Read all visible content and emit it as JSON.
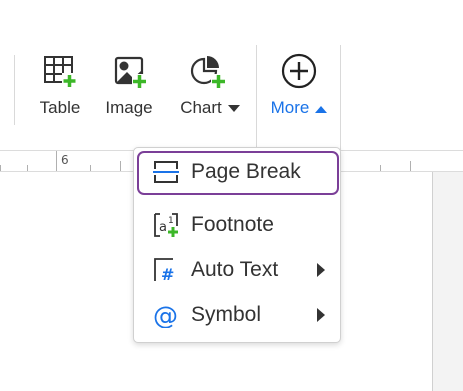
{
  "toolbar": {
    "table_label": "Table",
    "image_label": "Image",
    "chart_label": "Chart",
    "more_label": "More"
  },
  "ruler": {
    "mark": "6"
  },
  "more_menu": {
    "items": [
      {
        "label": "Page Break",
        "icon": "page-break-icon",
        "selected": true
      },
      {
        "label": "Footnote",
        "icon": "footnote-icon"
      },
      {
        "label": "Auto Text",
        "icon": "auto-text-icon",
        "submenu": true
      },
      {
        "label": "Symbol",
        "icon": "at-symbol-icon",
        "submenu": true
      }
    ]
  },
  "colors": {
    "accent": "#1a73e8",
    "selection_border": "#7b3f98",
    "plus_green": "#3cb728",
    "text": "#333333"
  }
}
